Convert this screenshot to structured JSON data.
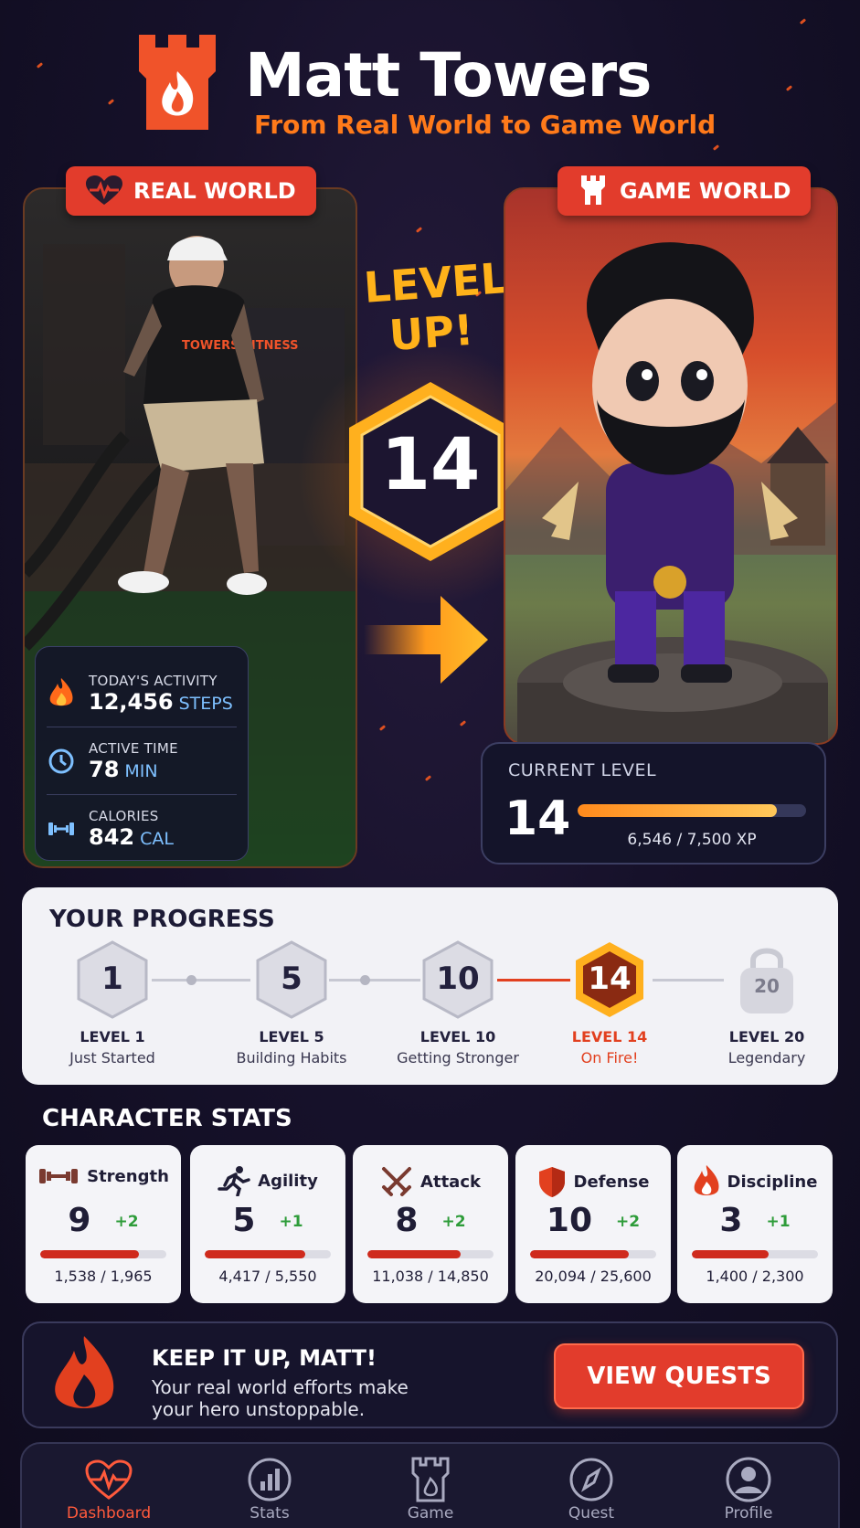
{
  "header": {
    "title": "Matt Towers",
    "subtitle": "From Real World to Game World"
  },
  "real_world": {
    "tag": "REAL WORLD",
    "shirt_text": "TOWERS FITNESS",
    "activity": [
      {
        "label": "TODAY'S ACTIVITY",
        "value": "12,456",
        "unit": "STEPS",
        "icon": "flame-icon"
      },
      {
        "label": "ACTIVE TIME",
        "value": "78",
        "unit": "MIN",
        "icon": "clock-icon"
      },
      {
        "label": "CALORIES",
        "value": "842",
        "unit": "CAL",
        "icon": "dumbbell-icon"
      }
    ]
  },
  "level_up": {
    "line1": "LEVEL",
    "line2": "UP!",
    "level": "14"
  },
  "game_world": {
    "tag": "GAME WORLD",
    "current_level_label": "CURRENT LEVEL",
    "current_level": "14",
    "xp_text": "6,546 / 7,500 XP",
    "xp_fraction": 0.873
  },
  "progress": {
    "title": "YOUR PROGRESS",
    "milestones": [
      {
        "num": "1",
        "level": "LEVEL 1",
        "sub": "Just Started"
      },
      {
        "num": "5",
        "level": "LEVEL 5",
        "sub": "Building Habits"
      },
      {
        "num": "10",
        "level": "LEVEL 10",
        "sub": "Getting Stronger"
      },
      {
        "num": "14",
        "level": "LEVEL 14",
        "sub": "On Fire!"
      },
      {
        "num": "20",
        "level": "LEVEL 20",
        "sub": "Legendary"
      }
    ]
  },
  "stats": {
    "title": "CHARACTER STATS",
    "items": [
      {
        "name": "Strength",
        "value": "9",
        "bonus": "+2",
        "xp": "1,538 / 1,965",
        "fraction": 0.78,
        "icon": "dumbbell-icon"
      },
      {
        "name": "Agility",
        "value": "5",
        "bonus": "+1",
        "xp": "4,417 / 5,550",
        "fraction": 0.8,
        "icon": "runner-icon"
      },
      {
        "name": "Attack",
        "value": "8",
        "bonus": "+2",
        "xp": "11,038 / 14,850",
        "fraction": 0.74,
        "icon": "crossed-swords-icon"
      },
      {
        "name": "Defense",
        "value": "10",
        "bonus": "+2",
        "xp": "20,094 / 25,600",
        "fraction": 0.78,
        "icon": "shield-icon"
      },
      {
        "name": "Discipline",
        "value": "3",
        "bonus": "+1",
        "xp": "1,400 / 2,300",
        "fraction": 0.61,
        "icon": "flame-icon"
      }
    ]
  },
  "encourage": {
    "title": "KEEP IT UP, MATT!",
    "text": "Your real world efforts make your hero unstoppable.",
    "button": "VIEW QUESTS"
  },
  "nav": {
    "items": [
      {
        "label": "Dashboard",
        "icon": "heartbeat-icon",
        "active": true
      },
      {
        "label": "Stats",
        "icon": "bar-chart-icon",
        "active": false
      },
      {
        "label": "Game",
        "icon": "castle-icon",
        "active": false
      },
      {
        "label": "Quest",
        "icon": "compass-icon",
        "active": false
      },
      {
        "label": "Profile",
        "icon": "user-icon",
        "active": false
      }
    ]
  },
  "colors": {
    "accent": "#e23c2c",
    "orange": "#ff7a1a",
    "gold": "#ffb21a",
    "bonus_green": "#2e9c3a"
  }
}
